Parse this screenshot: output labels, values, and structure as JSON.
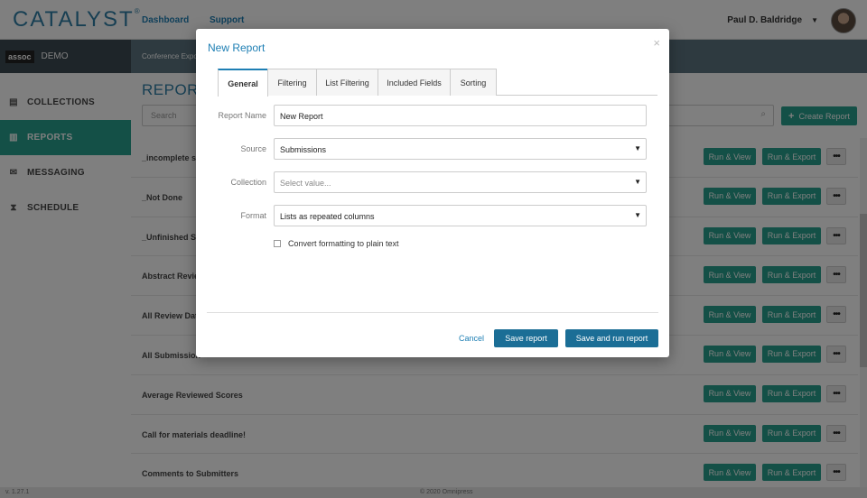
{
  "app": {
    "logo": "CATALYST",
    "logo_mark": "®"
  },
  "topnav": {
    "items": [
      "Dashboard",
      "Support"
    ]
  },
  "user": {
    "name": "Paul D. Baldridge",
    "caret": "▼"
  },
  "org": {
    "logo": "assoc",
    "name": "DEMO"
  },
  "sidebar": {
    "items": [
      {
        "label": "COLLECTIONS",
        "icon": "collections-icon",
        "active": false
      },
      {
        "label": "REPORTS",
        "icon": "bar-chart-icon",
        "active": true
      },
      {
        "label": "MESSAGING",
        "icon": "envelope-icon",
        "active": false
      },
      {
        "label": "SCHEDULE",
        "icon": "hourglass-icon",
        "active": false
      }
    ]
  },
  "subbar": {
    "text": "Conference Expo"
  },
  "main": {
    "title": "REPORTS",
    "search_placeholder": "Search",
    "create_label": "Create Report",
    "run_view_label": "Run & View",
    "run_export_label": "Run & Export",
    "more_label": "•••",
    "reports": [
      "_incomplete su",
      "_Not Done",
      "_Unfinished Su",
      "Abstract Revie",
      "All Review Dat",
      "All Submission",
      "Average Reviewed Scores",
      "Call for materials deadline!",
      "Comments to Submitters"
    ]
  },
  "footer": {
    "version": "v. 1.27.1",
    "copyright": "© 2020 Omnipress"
  },
  "modal": {
    "title": "New Report",
    "close": "×",
    "tabs": [
      {
        "label": "General",
        "active": true
      },
      {
        "label": "Filtering",
        "active": false
      },
      {
        "label": "List Filtering",
        "active": false
      },
      {
        "label": "Included Fields",
        "active": false
      },
      {
        "label": "Sorting",
        "active": false
      }
    ],
    "fields": {
      "report_name": {
        "label": "Report Name",
        "value": "New Report"
      },
      "source": {
        "label": "Source",
        "value": "Submissions"
      },
      "collection": {
        "label": "Collection",
        "placeholder": "Select value..."
      },
      "format": {
        "label": "Format",
        "value": "Lists as repeated columns"
      }
    },
    "checkbox_label": "Convert formatting to plain text",
    "checkbox_checked": false,
    "cancel_label": "Cancel",
    "save_label": "Save report",
    "save_run_label": "Save and run report"
  },
  "colors": {
    "accent": "#29a18e",
    "brand_blue": "#1e7fb4",
    "primary_button": "#1b6e96",
    "subbar": "#5c7580",
    "org_bar": "#3d4b52"
  }
}
